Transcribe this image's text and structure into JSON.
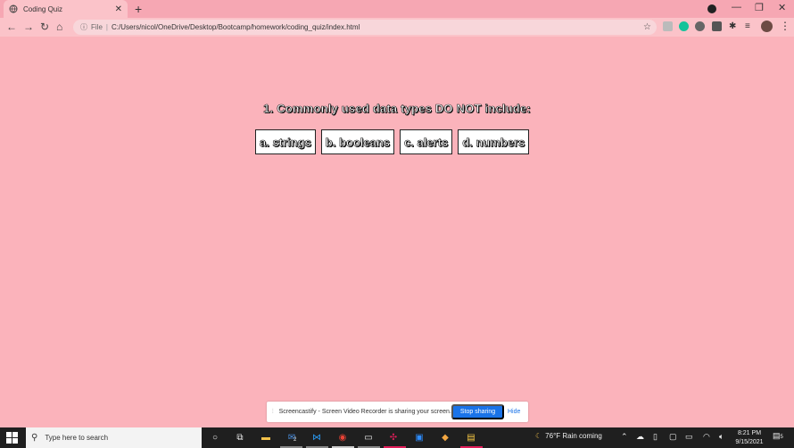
{
  "browser": {
    "tab_title": "Coding Quiz",
    "tab_close": "✕",
    "new_tab": "+",
    "url_prefix": "File",
    "url": "C:/Users/nicol/OneDrive/Desktop/Bootcamp/homework/coding_quiz/index.html"
  },
  "quiz": {
    "question": "1. Commonly used data types DO NOT include:",
    "answers": [
      "a. strings",
      "b. booleans",
      "c. alerts",
      "d. numbers"
    ]
  },
  "share_bar": {
    "message": "Screencastify - Screen Video Recorder is sharing your screen.",
    "stop_label": "Stop sharing",
    "hide_label": "Hide",
    "accent": "#1a73e8"
  },
  "taskbar": {
    "search_placeholder": "Type here to search",
    "weather": "76°F  Rain coming",
    "time": "8:21 PM",
    "date": "9/15/2021",
    "notifications": "5",
    "mail_badge": "2"
  },
  "colors": {
    "page_bg": "#fbb3bb",
    "toolbar_bg": "#fbc3c9",
    "tabstrip_bg": "#f6a7b3"
  }
}
